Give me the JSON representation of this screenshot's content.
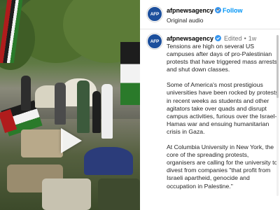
{
  "video": {
    "play_icon": "play-icon"
  },
  "header": {
    "avatar_text": "AFP",
    "account_name": "afpnewsagency",
    "follow_label": "Follow",
    "separator": "•",
    "audio_label": "Original audio"
  },
  "caption": {
    "avatar_text": "AFP",
    "account_name": "afpnewsagency",
    "edited_label": "Edited",
    "separator": "•",
    "time": "1w",
    "paragraphs": [
      "Tensions are high on several US campuses after days of pro-Palestinian protests that have triggered mass arrests and shut down classes.",
      "Some of America's most prestigious universities have been rocked by protests in recent weeks as students and other agitators take over quads and disrupt campus activities, furious over the Israel-Hamas war and ensuing humanitarian crisis in Gaza.",
      "At Columbia University in New York, the core of the spreading protests, organisers are calling for the university to divest from companies \"that profit from Israeli apartheid, genocide and occupation in Palestine.\""
    ]
  },
  "colors": {
    "follow": "#0095f6",
    "avatar_bg": "#1c4f9c",
    "verified": "#3897f0"
  }
}
